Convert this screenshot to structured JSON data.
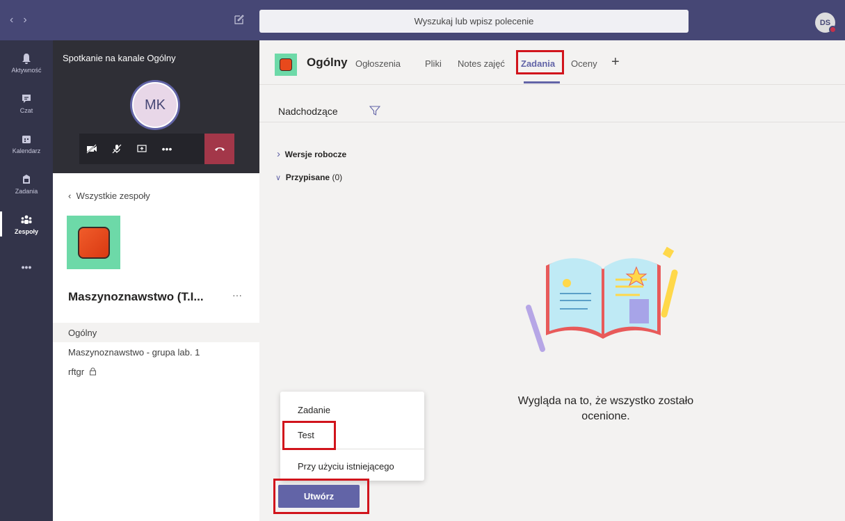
{
  "topbar": {
    "search_placeholder": "Wyszukaj lub wpisz polecenie",
    "user_initials": "DS"
  },
  "rail": {
    "items": [
      {
        "label": "Aktywność",
        "icon": "bell-icon"
      },
      {
        "label": "Czat",
        "icon": "chat-icon"
      },
      {
        "label": "Kalendarz",
        "icon": "calendar-icon"
      },
      {
        "label": "Zadania",
        "icon": "assignments-icon"
      },
      {
        "label": "Zespoły",
        "icon": "teams-icon"
      }
    ],
    "more": "•••"
  },
  "meeting": {
    "title": "Spotkanie na kanale Ogólny",
    "participant_initials": "MK",
    "more": "•••"
  },
  "team": {
    "back_label": "Wszystkie zespoły",
    "name": "Maszynoznawstwo (T.I...",
    "more": "···",
    "channels": [
      "Ogólny",
      "Maszynoznawstwo - grupa lab. 1",
      "rftgr"
    ]
  },
  "header": {
    "channel": "Ogólny",
    "tabs": [
      "Ogłoszenia",
      "Pliki",
      "Notes zajęć",
      "Zadania",
      "Oceny"
    ],
    "add": "+"
  },
  "assignments": {
    "filter_label": "Nadchodzące",
    "drafts": "Wersje robocze",
    "assigned": "Przypisane",
    "assigned_count": "(0)",
    "empty_line1": "Wygląda na to, że wszystko zostało",
    "empty_line2": "ocenione."
  },
  "create_menu": {
    "items": [
      "Zadanie",
      "Test",
      "Przy użyciu istniejącego"
    ],
    "button": "Utwórz"
  },
  "colors": {
    "topbar": "#464775",
    "rail": "#33344a",
    "accent": "#6264a7",
    "highlight": "#d1141c",
    "team_logo_bg": "#6dd9a8"
  }
}
